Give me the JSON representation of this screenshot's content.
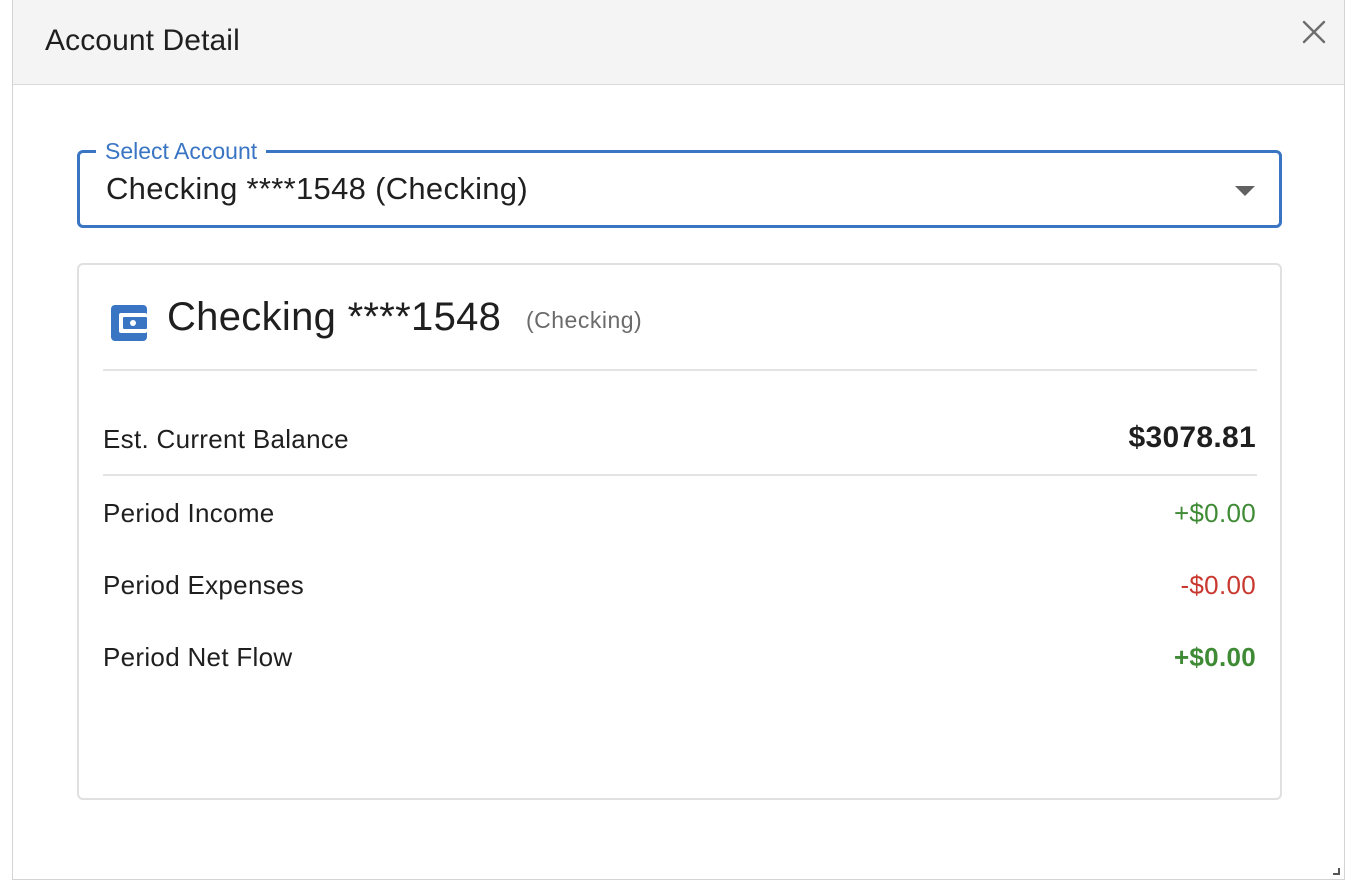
{
  "dialog": {
    "title": "Account Detail",
    "close_icon": "close-icon"
  },
  "select": {
    "label": "Select Account",
    "value": "Checking ****1548 (Checking)"
  },
  "account": {
    "icon": "wallet-icon",
    "icon_color": "#3a75c4",
    "name": "Checking ****1548",
    "type": "(Checking)"
  },
  "rows": [
    {
      "label": "Est. Current Balance",
      "value": "$3078.81"
    },
    {
      "label": "Period Income",
      "value": "+$0.00"
    },
    {
      "label": "Period Expenses",
      "value": "-$0.00"
    },
    {
      "label": "Period Net Flow",
      "value": "+$0.00"
    }
  ],
  "colors": {
    "accent": "#3a75c4",
    "positive": "#3f8a35",
    "negative": "#c9382f"
  }
}
